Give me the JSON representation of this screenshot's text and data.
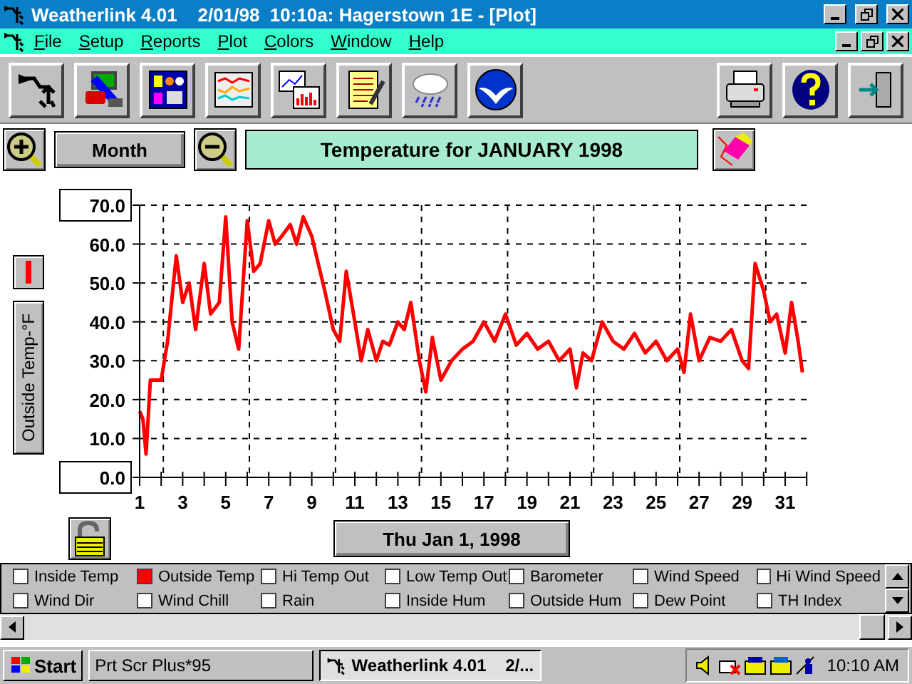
{
  "window": {
    "title": "Weatherlink 4.01    2/01/98  10:10a: Hagerstown 1E - [Plot]"
  },
  "menu": [
    "File",
    "Setup",
    "Reports",
    "Plot",
    "Colors",
    "Window",
    "Help"
  ],
  "controls": {
    "zoom_label": "Month",
    "plot_title": "Temperature for JANUARY 1998",
    "axis_label": "Outside Temp-°F",
    "date": "Thu Jan 1, 1998"
  },
  "chart_data": {
    "type": "line",
    "grid": true,
    "xlim": [
      1,
      32
    ],
    "ylim": [
      0,
      70
    ],
    "xticks": [
      1,
      3,
      5,
      7,
      9,
      11,
      13,
      15,
      17,
      19,
      21,
      23,
      25,
      27,
      29,
      31
    ],
    "yticks": [
      {
        "value": 0,
        "label": "0.0"
      },
      {
        "value": 10,
        "label": "10.0"
      },
      {
        "value": 20,
        "label": "20.0"
      },
      {
        "value": 30,
        "label": "30.0"
      },
      {
        "value": 40,
        "label": "40.0"
      },
      {
        "value": 50,
        "label": "50.0"
      },
      {
        "value": 60,
        "label": "60.0"
      },
      {
        "value": 70,
        "label": "70.0"
      }
    ],
    "x": [
      1,
      1.15,
      1.3,
      1.5,
      2,
      2.3,
      2.7,
      3,
      3.3,
      3.6,
      4,
      4.3,
      4.7,
      5,
      5.3,
      5.6,
      6,
      6.3,
      6.6,
      7,
      7.3,
      7.6,
      8,
      8.3,
      8.6,
      9,
      9.3,
      9.6,
      10,
      10.3,
      10.6,
      11,
      11.3,
      11.6,
      12,
      12.3,
      12.6,
      13,
      13.3,
      13.6,
      14,
      14.3,
      14.6,
      15,
      15.5,
      16,
      16.5,
      17,
      17.5,
      18,
      18.5,
      19,
      19.5,
      20,
      20.5,
      21,
      21.3,
      21.6,
      22,
      22.5,
      23,
      23.5,
      24,
      24.5,
      25,
      25.5,
      26,
      26.3,
      26.6,
      27,
      27.5,
      28,
      28.5,
      29,
      29.3,
      29.6,
      30,
      30.3,
      30.6,
      31,
      31.3,
      31.6,
      31.8
    ],
    "series": [
      {
        "color": "#ff0000",
        "values": [
          17,
          15,
          6,
          25,
          25,
          35,
          57,
          45,
          50,
          38,
          55,
          42,
          45,
          67,
          40,
          33,
          66,
          53,
          55,
          66,
          60,
          62,
          65,
          60,
          67,
          62,
          55,
          48,
          38,
          35,
          53,
          40,
          30,
          38,
          30,
          35,
          34,
          40,
          38,
          45,
          30,
          22,
          36,
          25,
          30,
          33,
          35,
          40,
          35,
          42,
          34,
          37,
          33,
          35,
          30,
          33,
          23,
          32,
          30,
          40,
          35,
          33,
          37,
          32,
          35,
          30,
          33,
          27,
          42,
          30,
          36,
          35,
          38,
          30,
          28,
          55,
          48,
          40,
          42,
          32,
          45,
          35,
          27
        ]
      }
    ]
  },
  "legend": [
    {
      "label": "Inside Temp",
      "checked": false
    },
    {
      "label": "Outside Temp",
      "checked": true
    },
    {
      "label": "Hi Temp Out",
      "checked": false
    },
    {
      "label": "Low Temp Out",
      "checked": false
    },
    {
      "label": "Barometer",
      "checked": false
    },
    {
      "label": "Wind Speed",
      "checked": false
    },
    {
      "label": "Hi Wind Speed",
      "checked": false
    },
    {
      "label": "Wind Dir",
      "checked": false
    },
    {
      "label": "Wind Chill",
      "checked": false
    },
    {
      "label": "Rain",
      "checked": false
    },
    {
      "label": "Inside Hum",
      "checked": false
    },
    {
      "label": "Outside Hum",
      "checked": false
    },
    {
      "label": "Dew Point",
      "checked": false
    },
    {
      "label": "TH Index",
      "checked": false
    }
  ],
  "taskbar": {
    "start": "Start",
    "tasks": [
      {
        "label": "Prt Scr Plus*95",
        "selected": false
      },
      {
        "label": "Weatherlink 4.01    2/...",
        "selected": true
      }
    ],
    "clock": "10:10 AM"
  }
}
